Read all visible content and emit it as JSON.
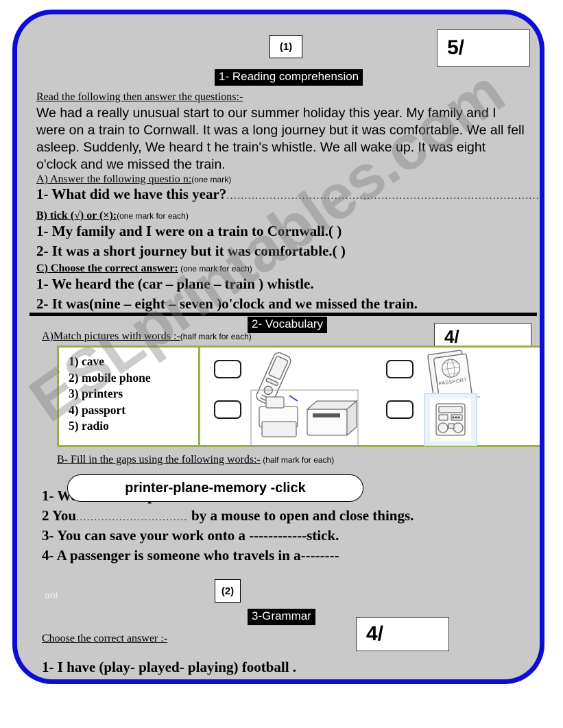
{
  "worksheet": {
    "page_marker_top": "(1)",
    "page_marker_bottom": "(2)",
    "watermark": "ESLprintables.com",
    "stray_text": "ant",
    "colors": {
      "border_blue": "#0d0dd6",
      "page_gray": "#c9c9c9",
      "table_green": "#96b04e",
      "header_black": "#000000"
    }
  },
  "section1": {
    "heading": "1- Reading comprehension",
    "score": "5/",
    "instruction": "Read the following then answer the questions:-",
    "passage": "We had a really unusual start to our summer holiday this year. My family and I were on a train to Cornwall. It was a long journey but it was comfortable. We all fell asleep. Suddenly, We heard t he train's whistle. We all wake up. It was eight o'clock and we missed the train.",
    "partA": {
      "label": "A)  Answer the following questio n:",
      "marks": "(one mark)",
      "questions": [
        {
          "num": "1-",
          "text": "What did we have this year?",
          "answer_dots": "........................................................................................."
        }
      ]
    },
    "partB": {
      "label": "B)  tick (√) or (×):",
      "marks": "(one mark for each)",
      "questions": [
        {
          "num": "1-",
          "text": "My family and I were  on a train to Cornwall.(   )"
        },
        {
          "num": "2-",
          "text": "It was a short journey but it was  comfortable.(   )"
        }
      ]
    },
    "partC": {
      "label": "C)  Choose the correct answer:",
      "marks": " (one mark for each)",
      "questions": [
        {
          "num": "1-",
          "text": "We heard the (car – plane – train ) whistle."
        },
        {
          "num": "2-",
          "text": "It was(nine – eight – seven )o'clock and we missed the train."
        }
      ]
    }
  },
  "section2": {
    "heading": "2- Vocabulary",
    "score": "4/",
    "partA": {
      "label": "A)Match pictures with words :-",
      "marks": "(half mark for each)",
      "words": [
        "1) cave",
        "2) mobile phone",
        "3)  printers",
        "4)  passport",
        "5)  radio"
      ],
      "pictures": [
        {
          "name": "mobile-phone",
          "answer": ""
        },
        {
          "name": "passport",
          "answer": ""
        },
        {
          "name": "printers",
          "answer": ""
        },
        {
          "name": "radio",
          "answer": ""
        }
      ]
    },
    "partB": {
      "label": "B- Fill in the gaps using the following words:-",
      "marks": " (half mark for each)",
      "word_bank": "printer-plane-memory -click",
      "questions": [
        {
          "num": "1-",
          "pre": "We use  ",
          "gap": "............",
          "post": "print our  documents."
        },
        {
          "num": "2",
          "pre": "You",
          "gap": "...............................",
          "post": " by a mouse to open and close things."
        },
        {
          "num": "3-",
          "pre": "You can save your work onto a ",
          "gap": "------------",
          "post": "stick."
        },
        {
          "num": "4-",
          "pre": "A passenger is someone who travels in a",
          "gap": "--------",
          "post": ""
        }
      ]
    }
  },
  "section3": {
    "heading": "3-Grammar",
    "score": "4/",
    "instruction": "Choose the correct answer :-",
    "questions": [
      {
        "num": "1-",
        "text": "I have (play- played- playing) football ."
      }
    ]
  }
}
